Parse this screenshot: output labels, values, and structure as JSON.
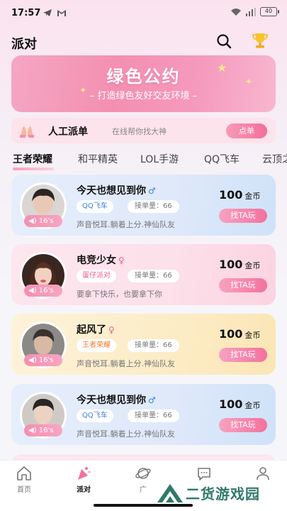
{
  "status": {
    "time": "17:57",
    "battery": "40"
  },
  "header": {
    "title": "派对"
  },
  "banner": {
    "title": "绿色公约",
    "subtitle": "– 打造绿色友好交友环境 –"
  },
  "dispatch": {
    "title": "人工派单",
    "subtitle": "在线帮你找大神",
    "button": "点单"
  },
  "tabs": [
    "王者荣耀",
    "和平精英",
    "LOL手游",
    "QQ飞车",
    "云顶之"
  ],
  "cards": [
    {
      "name": "今天也想见到你",
      "gender": "♂",
      "game": "QQ飞车",
      "orders": "接单量：66",
      "desc": "声音悦耳.躺着上分.神仙队友",
      "voice": "16's",
      "price": "100",
      "unit": "金币",
      "button": "找TA玩"
    },
    {
      "name": "电竞少女",
      "gender": "♀",
      "game": "蛋仔派对",
      "orders": "接单量：66",
      "desc": "要拿下快乐，也要拿下你",
      "voice": "16's",
      "price": "100",
      "unit": "金币",
      "button": "找TA玩"
    },
    {
      "name": "起风了",
      "gender": "♀",
      "game": "王者荣耀",
      "orders": "接单量：66",
      "desc": "声音悦耳.躺着上分.神仙队友",
      "voice": "16's",
      "price": "100",
      "unit": "金币",
      "button": "找TA玩"
    },
    {
      "name": "今天也想见到你",
      "gender": "♂",
      "game": "QQ飞车",
      "orders": "接单量：66",
      "desc": "声音悦耳.躺着上分.神仙队友",
      "voice": "16's",
      "price": "100",
      "unit": "金币",
      "button": "找TA玩"
    }
  ],
  "nav": [
    {
      "label": "首页",
      "icon": "home-icon"
    },
    {
      "label": "派对",
      "icon": "party-icon"
    },
    {
      "label": "广",
      "icon": "planet-icon"
    },
    {
      "label": "",
      "icon": "chat-icon"
    },
    {
      "label": "",
      "icon": "profile-icon"
    }
  ],
  "watermark": {
    "text": "二货游戏园"
  },
  "colors": {
    "accent": "#f4719c",
    "blue_tag": "#3d7fe0",
    "pink_tag": "#ec5c8e",
    "orange_tag": "#f07a2a"
  }
}
